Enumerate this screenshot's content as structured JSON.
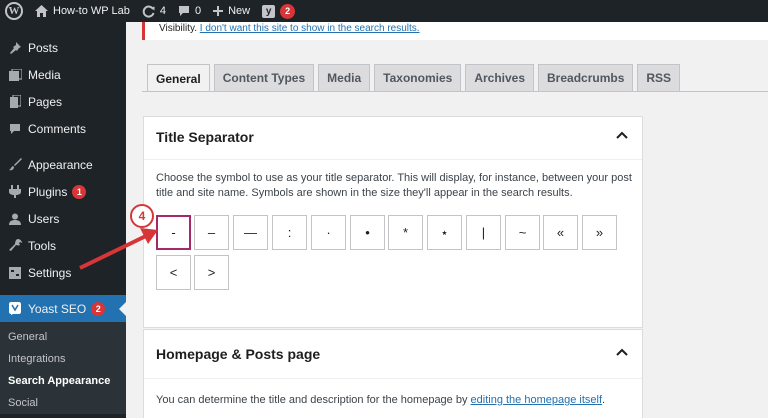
{
  "adminbar": {
    "site_name": "How-to WP Lab",
    "updates_count": "4",
    "comments_count": "0",
    "new_label": "New",
    "yoast_count": "2"
  },
  "sidebar": {
    "items": [
      {
        "label": "Posts",
        "icon": "pin-icon"
      },
      {
        "label": "Media",
        "icon": "media-icon"
      },
      {
        "label": "Pages",
        "icon": "pages-icon"
      },
      {
        "label": "Comments",
        "icon": "comment-icon"
      },
      {
        "label": "Appearance",
        "icon": "brush-icon"
      },
      {
        "label": "Plugins",
        "icon": "plugin-icon",
        "badge": "1"
      },
      {
        "label": "Users",
        "icon": "user-icon"
      },
      {
        "label": "Tools",
        "icon": "wrench-icon"
      },
      {
        "label": "Settings",
        "icon": "settings-icon"
      },
      {
        "label": "Yoast SEO",
        "icon": "yoast-icon",
        "badge": "2"
      }
    ],
    "submenu": [
      "General",
      "Integrations",
      "Search Appearance",
      "Social"
    ]
  },
  "notice": {
    "prefix": "Visibility.",
    "link": "I don't want this site to show in the search results."
  },
  "tabs": [
    "General",
    "Content Types",
    "Media",
    "Taxonomies",
    "Archives",
    "Breadcrumbs",
    "RSS"
  ],
  "title_separator": {
    "title": "Title Separator",
    "description": "Choose the symbol to use as your title separator. This will display, for instance, between your post title and site name. Symbols are shown in the size they'll appear in the search results.",
    "symbols": [
      "-",
      "–",
      "—",
      ":",
      "·",
      "•",
      "*",
      "⋆",
      "|",
      "~",
      "«",
      "»",
      "<",
      ">"
    ],
    "selected_index": 0
  },
  "homepage_section": {
    "title": "Homepage & Posts page",
    "desc_prefix": "You can determine the title and description for the homepage by ",
    "desc_link": "editing the homepage itself",
    "desc_suffix": "."
  },
  "annotation": {
    "step_number": "4",
    "color": "#d63638"
  },
  "colors": {
    "adminbar_bg": "#1d2327",
    "accent": "#2271b1",
    "selected_border": "#a4286a",
    "badge": "#d63638"
  }
}
